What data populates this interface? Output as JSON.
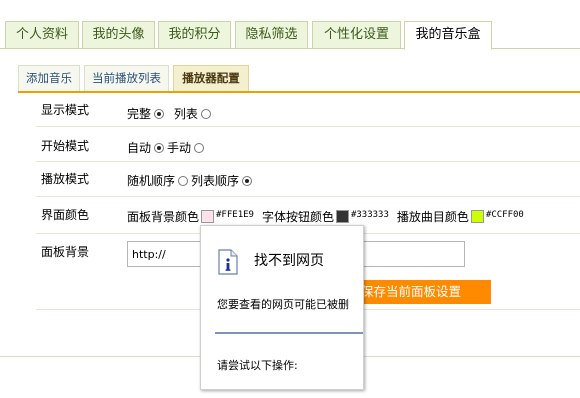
{
  "tabs": [
    "个人资料",
    "我的头像",
    "我的积分",
    "隐私筛选",
    "个性化设置",
    "我的音乐盒"
  ],
  "active_tab_index": 5,
  "sub_tabs": [
    "添加音乐",
    "当前播放列表",
    "播放器配置"
  ],
  "active_sub_tab_index": 2,
  "settings": {
    "display_mode": {
      "label": "显示模式",
      "options": [
        "完整",
        "列表"
      ],
      "selected": "完整"
    },
    "start_mode": {
      "label": "开始模式",
      "options": [
        "自动",
        "手动"
      ],
      "selected": "自动"
    },
    "play_mode": {
      "label": "播放模式",
      "options": [
        "随机顺序",
        "列表顺序"
      ],
      "selected": "列表顺序"
    },
    "colors": {
      "label": "界面颜色",
      "swatches": [
        {
          "label": "面板背景颜色",
          "hex": "#FFE1E9"
        },
        {
          "label": "字体按钮颜色",
          "hex": "#333333"
        },
        {
          "label": "播放曲目颜色",
          "hex": "#CCFF00"
        }
      ]
    },
    "background": {
      "label": "面板背景",
      "url_value": "http://"
    }
  },
  "save_button": "保存当前面板设置",
  "error_popup": {
    "title": "找不到网页",
    "line1": "您要查看的网页可能已被删",
    "line2": "请尝试以下操作:"
  }
}
